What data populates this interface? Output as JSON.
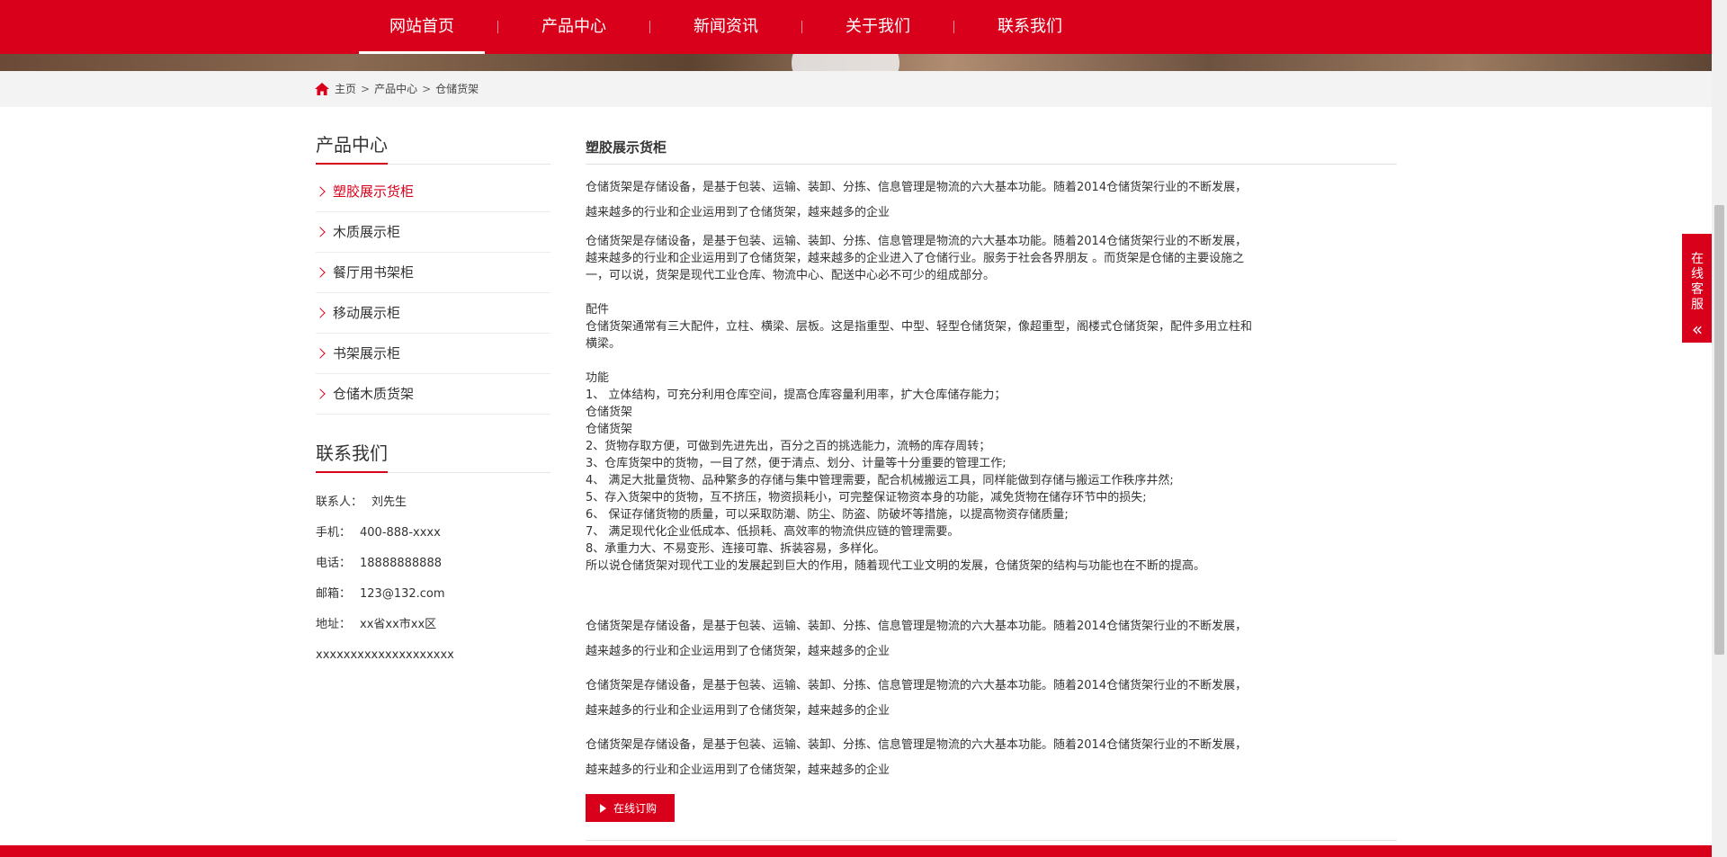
{
  "nav": {
    "items": [
      "网站首页",
      "产品中心",
      "新闻资讯",
      "关于我们",
      "联系我们"
    ],
    "active": 0
  },
  "breadcrumb": {
    "home": "主页",
    "level1": "产品中心",
    "level2": "仓储货架",
    "separator": ">"
  },
  "sidebar": {
    "product_title": "产品中心",
    "categories": [
      "塑胶展示货柜",
      "木质展示柜",
      "餐厅用书架柜",
      "移动展示柜",
      "书架展示柜",
      "仓储木质货架"
    ],
    "active_category": 0,
    "contact_title": "联系我们",
    "contact": {
      "person_label": "联系人：",
      "person": "刘先生",
      "mobile_label": "手机：",
      "mobile": "400-888-xxxx",
      "phone_label": "电话：",
      "phone": "18888888888",
      "email_label": "邮箱：",
      "email": "123@132.com",
      "address_label": "地址：",
      "address": "xx省xx市xx区",
      "address2": "xxxxxxxxxxxxxxxxxxxx"
    }
  },
  "product": {
    "title": "塑胶展示货柜",
    "intro": [
      "仓储货架是存储设备，是基于包装、运输、装卸、分拣、信息管理是物流的六大基本功能。随着2014仓储货架行业的不断发展，",
      "越来越多的行业和企业运用到了仓储货架，越来越多的企业"
    ],
    "body": [
      " 仓储货架是存储设备，是基于包装、运输、装卸、分拣、信息管理是物流的六大基本功能。随着2014仓储货架行业的不断发展，",
      "越来越多的行业和企业运用到了仓储货架，越来越多的企业进入了仓储行业。服务于社会各界朋友 。而货架是仓储的主要设施之",
      "一，可以说，货架是现代工业仓库、物流中心、配送中心必不可少的组成部分。"
    ],
    "parts_title": "配件",
    "parts": [
      "仓储货架通常有三大配件，立柱、横梁、层板。这是指重型、中型、轻型仓储货架，像超重型，阁楼式仓储货架，配件多用立柱和",
      "横梁。"
    ],
    "func_title": "功能",
    "funcs": [
      "1、 立体结构，可充分利用仓库空间，提高仓库容量利用率，扩大仓库储存能力；",
      "仓储货架",
      "仓储货架",
      "2、货物存取方便，可做到先进先出，百分之百的挑选能力，流畅的库存周转；",
      "3、仓库货架中的货物，一目了然，便于清点、划分、计量等十分重要的管理工作;",
      "4、 满足大批量货物、品种繁多的存储与集中管理需要，配合机械搬运工具，同样能做到存储与搬运工作秩序井然;",
      "5、存入货架中的货物，互不挤压，物资损耗小，可完整保证物资本身的功能，减免货物在储存环节中的损失;",
      "6、 保证存储货物的质量，可以采取防潮、防尘、防盗、防破坏等措施，以提高物资存储质量;",
      "7、 满足现代化企业低成本、低损耗、高效率的物流供应链的管理需要。",
      "8、承重力大、不易变形、连接可靠、拆装容易，多样化。",
      "所以说仓储货架对现代工业的发展起到巨大的作用，随着现代工业文明的发展，仓储货架的结构与功能也在不断的提高。"
    ],
    "repeat": [
      [
        "仓储货架是存储设备，是基于包装、运输、装卸、分拣、信息管理是物流的六大基本功能。随着2014仓储货架行业的不断发展，",
        "越来越多的行业和企业运用到了仓储货架，越来越多的企业"
      ],
      [
        "仓储货架是存储设备，是基于包装、运输、装卸、分拣、信息管理是物流的六大基本功能。随着2014仓储货架行业的不断发展，",
        "越来越多的行业和企业运用到了仓储货架，越来越多的企业"
      ],
      [
        "仓储货架是存储设备，是基于包装、运输、装卸、分拣、信息管理是物流的六大基本功能。随着2014仓储货架行业的不断发展，",
        "越来越多的行业和企业运用到了仓储货架，越来越多的企业"
      ]
    ],
    "buy_label": "在线订购"
  },
  "service": {
    "label": "在线客服",
    "arrow": "«"
  },
  "colors": {
    "brand": "#d9001b",
    "breadcrumb_bg": "#f3f3f3"
  },
  "icons": {
    "home": "home-icon",
    "chevron": "chevron-right-icon",
    "play": "play-icon",
    "double_left": "double-chevron-left-icon"
  }
}
